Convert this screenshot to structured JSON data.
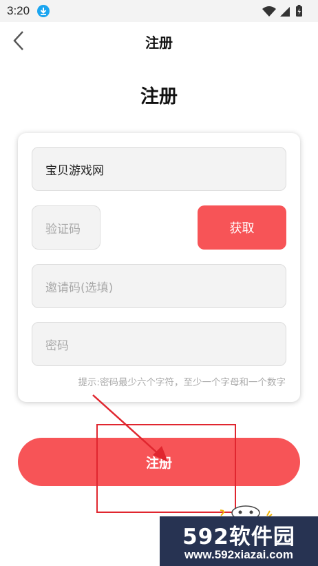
{
  "status_bar": {
    "time": "3:20"
  },
  "nav": {
    "title": "注册"
  },
  "page": {
    "heading": "注册"
  },
  "form": {
    "account_value": "宝贝游戏网",
    "code_placeholder": "验证码",
    "get_code_label": "获取",
    "invite_placeholder": "邀请码(选填)",
    "password_placeholder": "密码",
    "hint": "提示:密码最少六个字符，至少一个字母和一个数字"
  },
  "actions": {
    "register_label": "注册"
  },
  "watermark": {
    "brand": "592软件园",
    "url": "www.592xiazai.com"
  },
  "colors": {
    "accent": "#f75457",
    "annotation": "#e0262f",
    "watermark_bg": "#273352"
  }
}
